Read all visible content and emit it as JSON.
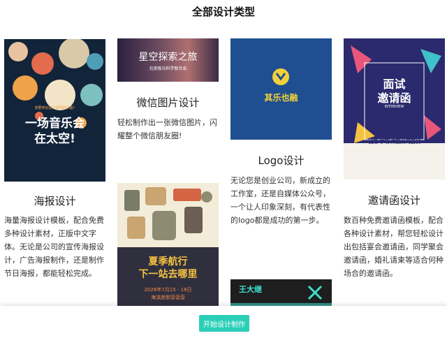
{
  "page": {
    "title": "全部设计类型"
  },
  "poster": {
    "title": "海报设计",
    "desc": "海量海报设计模板，配合免费多种设计素材，正版中文字体。无论是公司的宣传海报设计，广告海报制作，还是制作节日海报，都能轻松完成。",
    "img_headline1": "一场音乐会",
    "img_headline2": "在太空!",
    "img_small": "想要参加这个世界的乐趣?"
  },
  "wechat": {
    "title": "微信图片设计",
    "desc": "轻松制作出一张微信图片，闪耀整个微信朋友圈!",
    "img_headline": "星空探索之旅",
    "img_sub": "北夜极光科学联合会"
  },
  "logo": {
    "title": "Logo设计",
    "desc": "无论您是创业公司，新成立的工作室，还是自媒体公众号，一个让人印象深刻，有代表性的logo都是成功的第一步。",
    "img_name": "其乐也融"
  },
  "invite": {
    "title": "邀请函设计",
    "desc": "数百种免费邀请函模板，配合各种设计素材，帮您轻松设计出包括宴会邀请函，同学聚会邀请函，婚礼请柬等适合何种场合的邀请函。",
    "img_line1": "面试",
    "img_line2": "邀请函",
    "img_sub": "INTERVIEW",
    "img_bottom": "诚邀 李明 来我公司面试"
  },
  "summer": {
    "img_line1": "夏季航行",
    "img_line2": "下一站去哪里",
    "img_date": "2026年7月15 - 18日",
    "img_sub": "海滨度假营营营"
  },
  "bcard": {
    "img_name": "王大继"
  },
  "footer": {
    "start_button": "开始设计制作"
  },
  "colors": {
    "accent": "#2bcfb8"
  }
}
